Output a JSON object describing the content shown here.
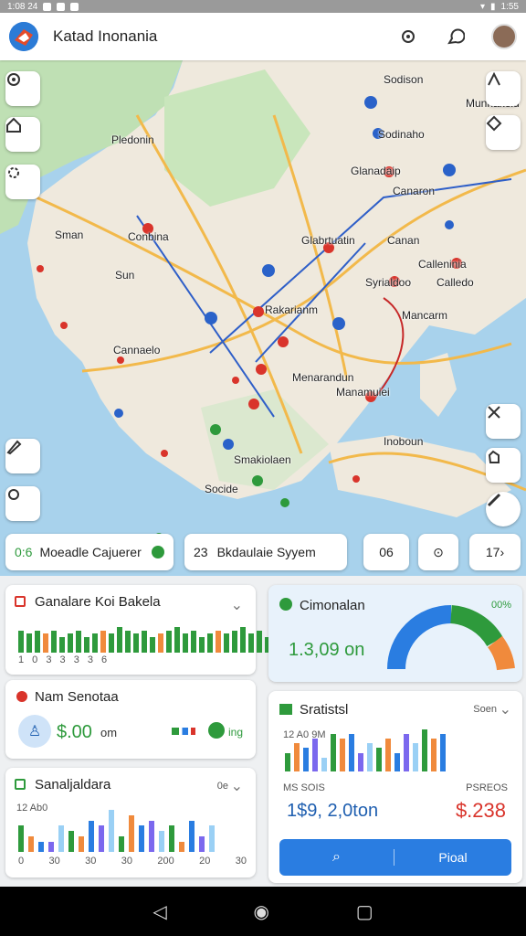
{
  "status_bar": {
    "left": "1:08 24",
    "right": "1:55"
  },
  "app": {
    "title": "Katad Inonania"
  },
  "map": {
    "labels": [
      "Pledonin",
      "Sodison",
      "Munnakeiu",
      "Glanadaip",
      "Canaron",
      "Sodinaho",
      "Sman",
      "Sun",
      "Glabrtuatin",
      "Canan",
      "Calleninia",
      "Syrialdoo",
      "Calledo",
      "Mancarm",
      "Cannaelo",
      "Rakarianm",
      "Menarandun",
      "Manamuiei",
      "Conbina",
      "Inoboun",
      "Smakiolaen",
      "Socide"
    ]
  },
  "chips": {
    "left_prefix": "0:6",
    "left_label": "Moeadle Cajuerer",
    "middle_prefix": "23",
    "middle_label": "Bkdaulaie Syyem",
    "right_a": "06",
    "right_c": "17"
  },
  "card1": {
    "title": "Ganalare Koi Bakela",
    "ticks": "1 0 3 3 3 3 6"
  },
  "card2": {
    "title": "Nam Senotaa",
    "value": "$.00",
    "unit": "om",
    "extra": "ing"
  },
  "card3": {
    "title": "Sanaljaldara",
    "badge": "0e",
    "axis_top": "12 Ab0",
    "ticks": [
      "0",
      "30",
      "30",
      "30",
      "200",
      "20",
      "30"
    ]
  },
  "gauge": {
    "title": "Cimonalan",
    "value": "1.3,09 on",
    "pct": "00%"
  },
  "stats": {
    "title": "Sratistsl",
    "dropdown": "Soen",
    "label_a": "12 A0 9M",
    "label_b": "MS SOIS",
    "value_a": "1$9, 2,0ton",
    "label_c": "PSREOS",
    "value_b": "$.238",
    "button": "Pioal"
  },
  "colors": {
    "primary": "#2a7de1",
    "green": "#2e9a3c",
    "red": "#d9342b",
    "orange": "#f08a3c",
    "purple": "#7b68ee"
  },
  "chart_data": [
    {
      "type": "bar",
      "values": [
        7,
        6,
        7,
        6,
        7,
        5,
        6,
        7,
        5,
        6,
        7,
        6,
        8,
        7,
        6,
        7,
        5,
        6,
        7,
        8,
        6,
        7,
        5,
        6,
        7,
        6,
        7,
        8,
        6,
        7,
        5,
        6
      ]
    },
    {
      "type": "bar",
      "values": [
        5,
        3,
        2,
        2,
        5,
        4,
        3,
        6,
        5,
        8,
        3,
        7,
        5,
        6,
        4,
        5,
        2,
        6,
        3,
        5
      ]
    },
    {
      "type": "bar",
      "values": [
        4,
        6,
        5,
        7,
        3,
        8,
        7,
        8,
        4,
        6,
        5,
        7,
        4,
        8,
        6,
        9,
        7,
        8
      ]
    }
  ]
}
